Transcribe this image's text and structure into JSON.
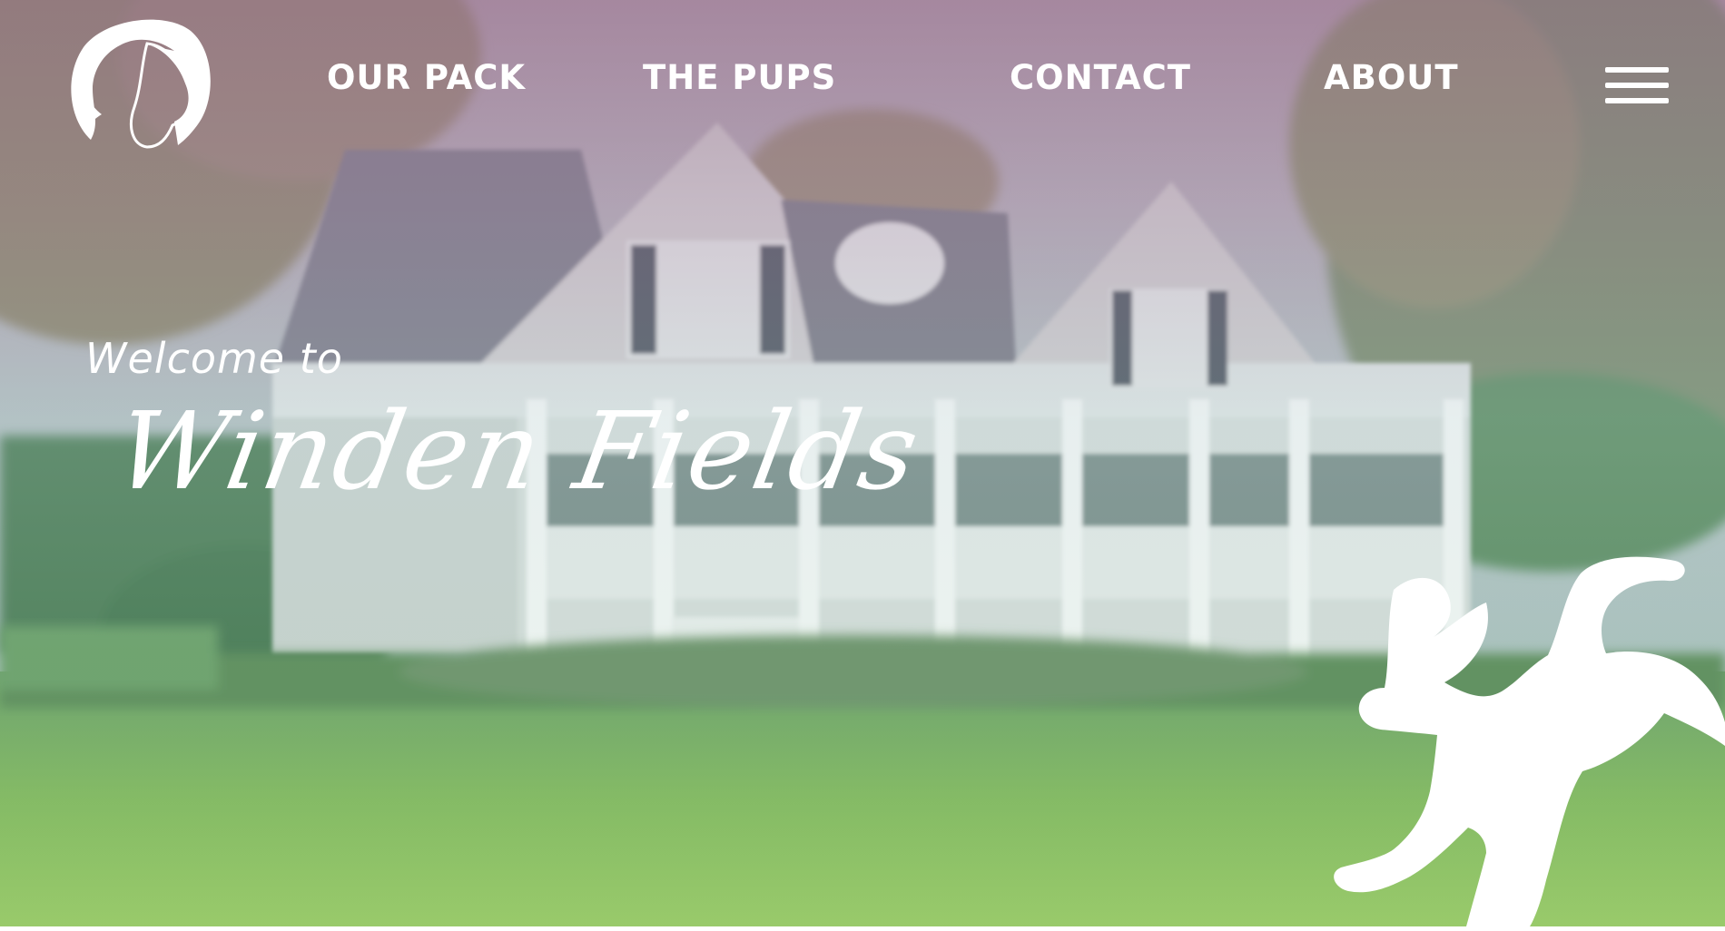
{
  "nav": {
    "items": [
      {
        "label": "OUR PACK"
      },
      {
        "label": "THE PUPS"
      },
      {
        "label": "CONTACT"
      },
      {
        "label": "ABOUT"
      }
    ],
    "menu_icon": "hamburger-icon"
  },
  "logo": {
    "icon": "dog-head-logo"
  },
  "hero": {
    "welcome": "Welcome to",
    "title": "Winden Fields"
  },
  "decoration": {
    "icon": "running-dog-silhouette"
  },
  "colors": {
    "text": "#ffffff",
    "tint_top": "#9a7390",
    "lawn": "#7fb15e"
  }
}
